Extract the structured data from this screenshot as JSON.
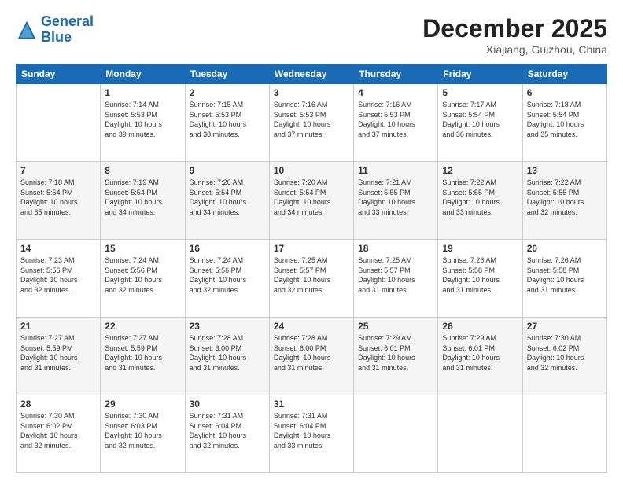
{
  "logo": {
    "line1": "General",
    "line2": "Blue"
  },
  "header": {
    "month": "December 2025",
    "location": "Xiajiang, Guizhou, China"
  },
  "days": [
    "Sunday",
    "Monday",
    "Tuesday",
    "Wednesday",
    "Thursday",
    "Friday",
    "Saturday"
  ],
  "weeks": [
    [
      {
        "day": "",
        "info": ""
      },
      {
        "day": "1",
        "info": "Sunrise: 7:14 AM\nSunset: 5:53 PM\nDaylight: 10 hours\nand 39 minutes."
      },
      {
        "day": "2",
        "info": "Sunrise: 7:15 AM\nSunset: 5:53 PM\nDaylight: 10 hours\nand 38 minutes."
      },
      {
        "day": "3",
        "info": "Sunrise: 7:16 AM\nSunset: 5:53 PM\nDaylight: 10 hours\nand 37 minutes."
      },
      {
        "day": "4",
        "info": "Sunrise: 7:16 AM\nSunset: 5:53 PM\nDaylight: 10 hours\nand 37 minutes."
      },
      {
        "day": "5",
        "info": "Sunrise: 7:17 AM\nSunset: 5:54 PM\nDaylight: 10 hours\nand 36 minutes."
      },
      {
        "day": "6",
        "info": "Sunrise: 7:18 AM\nSunset: 5:54 PM\nDaylight: 10 hours\nand 35 minutes."
      }
    ],
    [
      {
        "day": "7",
        "info": "Sunrise: 7:18 AM\nSunset: 5:54 PM\nDaylight: 10 hours\nand 35 minutes."
      },
      {
        "day": "8",
        "info": "Sunrise: 7:19 AM\nSunset: 5:54 PM\nDaylight: 10 hours\nand 34 minutes."
      },
      {
        "day": "9",
        "info": "Sunrise: 7:20 AM\nSunset: 5:54 PM\nDaylight: 10 hours\nand 34 minutes."
      },
      {
        "day": "10",
        "info": "Sunrise: 7:20 AM\nSunset: 5:54 PM\nDaylight: 10 hours\nand 34 minutes."
      },
      {
        "day": "11",
        "info": "Sunrise: 7:21 AM\nSunset: 5:55 PM\nDaylight: 10 hours\nand 33 minutes."
      },
      {
        "day": "12",
        "info": "Sunrise: 7:22 AM\nSunset: 5:55 PM\nDaylight: 10 hours\nand 33 minutes."
      },
      {
        "day": "13",
        "info": "Sunrise: 7:22 AM\nSunset: 5:55 PM\nDaylight: 10 hours\nand 32 minutes."
      }
    ],
    [
      {
        "day": "14",
        "info": "Sunrise: 7:23 AM\nSunset: 5:56 PM\nDaylight: 10 hours\nand 32 minutes."
      },
      {
        "day": "15",
        "info": "Sunrise: 7:24 AM\nSunset: 5:56 PM\nDaylight: 10 hours\nand 32 minutes."
      },
      {
        "day": "16",
        "info": "Sunrise: 7:24 AM\nSunset: 5:56 PM\nDaylight: 10 hours\nand 32 minutes."
      },
      {
        "day": "17",
        "info": "Sunrise: 7:25 AM\nSunset: 5:57 PM\nDaylight: 10 hours\nand 32 minutes."
      },
      {
        "day": "18",
        "info": "Sunrise: 7:25 AM\nSunset: 5:57 PM\nDaylight: 10 hours\nand 31 minutes."
      },
      {
        "day": "19",
        "info": "Sunrise: 7:26 AM\nSunset: 5:58 PM\nDaylight: 10 hours\nand 31 minutes."
      },
      {
        "day": "20",
        "info": "Sunrise: 7:26 AM\nSunset: 5:58 PM\nDaylight: 10 hours\nand 31 minutes."
      }
    ],
    [
      {
        "day": "21",
        "info": "Sunrise: 7:27 AM\nSunset: 5:59 PM\nDaylight: 10 hours\nand 31 minutes."
      },
      {
        "day": "22",
        "info": "Sunrise: 7:27 AM\nSunset: 5:59 PM\nDaylight: 10 hours\nand 31 minutes."
      },
      {
        "day": "23",
        "info": "Sunrise: 7:28 AM\nSunset: 6:00 PM\nDaylight: 10 hours\nand 31 minutes."
      },
      {
        "day": "24",
        "info": "Sunrise: 7:28 AM\nSunset: 6:00 PM\nDaylight: 10 hours\nand 31 minutes."
      },
      {
        "day": "25",
        "info": "Sunrise: 7:29 AM\nSunset: 6:01 PM\nDaylight: 10 hours\nand 31 minutes."
      },
      {
        "day": "26",
        "info": "Sunrise: 7:29 AM\nSunset: 6:01 PM\nDaylight: 10 hours\nand 31 minutes."
      },
      {
        "day": "27",
        "info": "Sunrise: 7:30 AM\nSunset: 6:02 PM\nDaylight: 10 hours\nand 32 minutes."
      }
    ],
    [
      {
        "day": "28",
        "info": "Sunrise: 7:30 AM\nSunset: 6:02 PM\nDaylight: 10 hours\nand 32 minutes."
      },
      {
        "day": "29",
        "info": "Sunrise: 7:30 AM\nSunset: 6:03 PM\nDaylight: 10 hours\nand 32 minutes."
      },
      {
        "day": "30",
        "info": "Sunrise: 7:31 AM\nSunset: 6:04 PM\nDaylight: 10 hours\nand 32 minutes."
      },
      {
        "day": "31",
        "info": "Sunrise: 7:31 AM\nSunset: 6:04 PM\nDaylight: 10 hours\nand 33 minutes."
      },
      {
        "day": "",
        "info": ""
      },
      {
        "day": "",
        "info": ""
      },
      {
        "day": "",
        "info": ""
      }
    ]
  ]
}
